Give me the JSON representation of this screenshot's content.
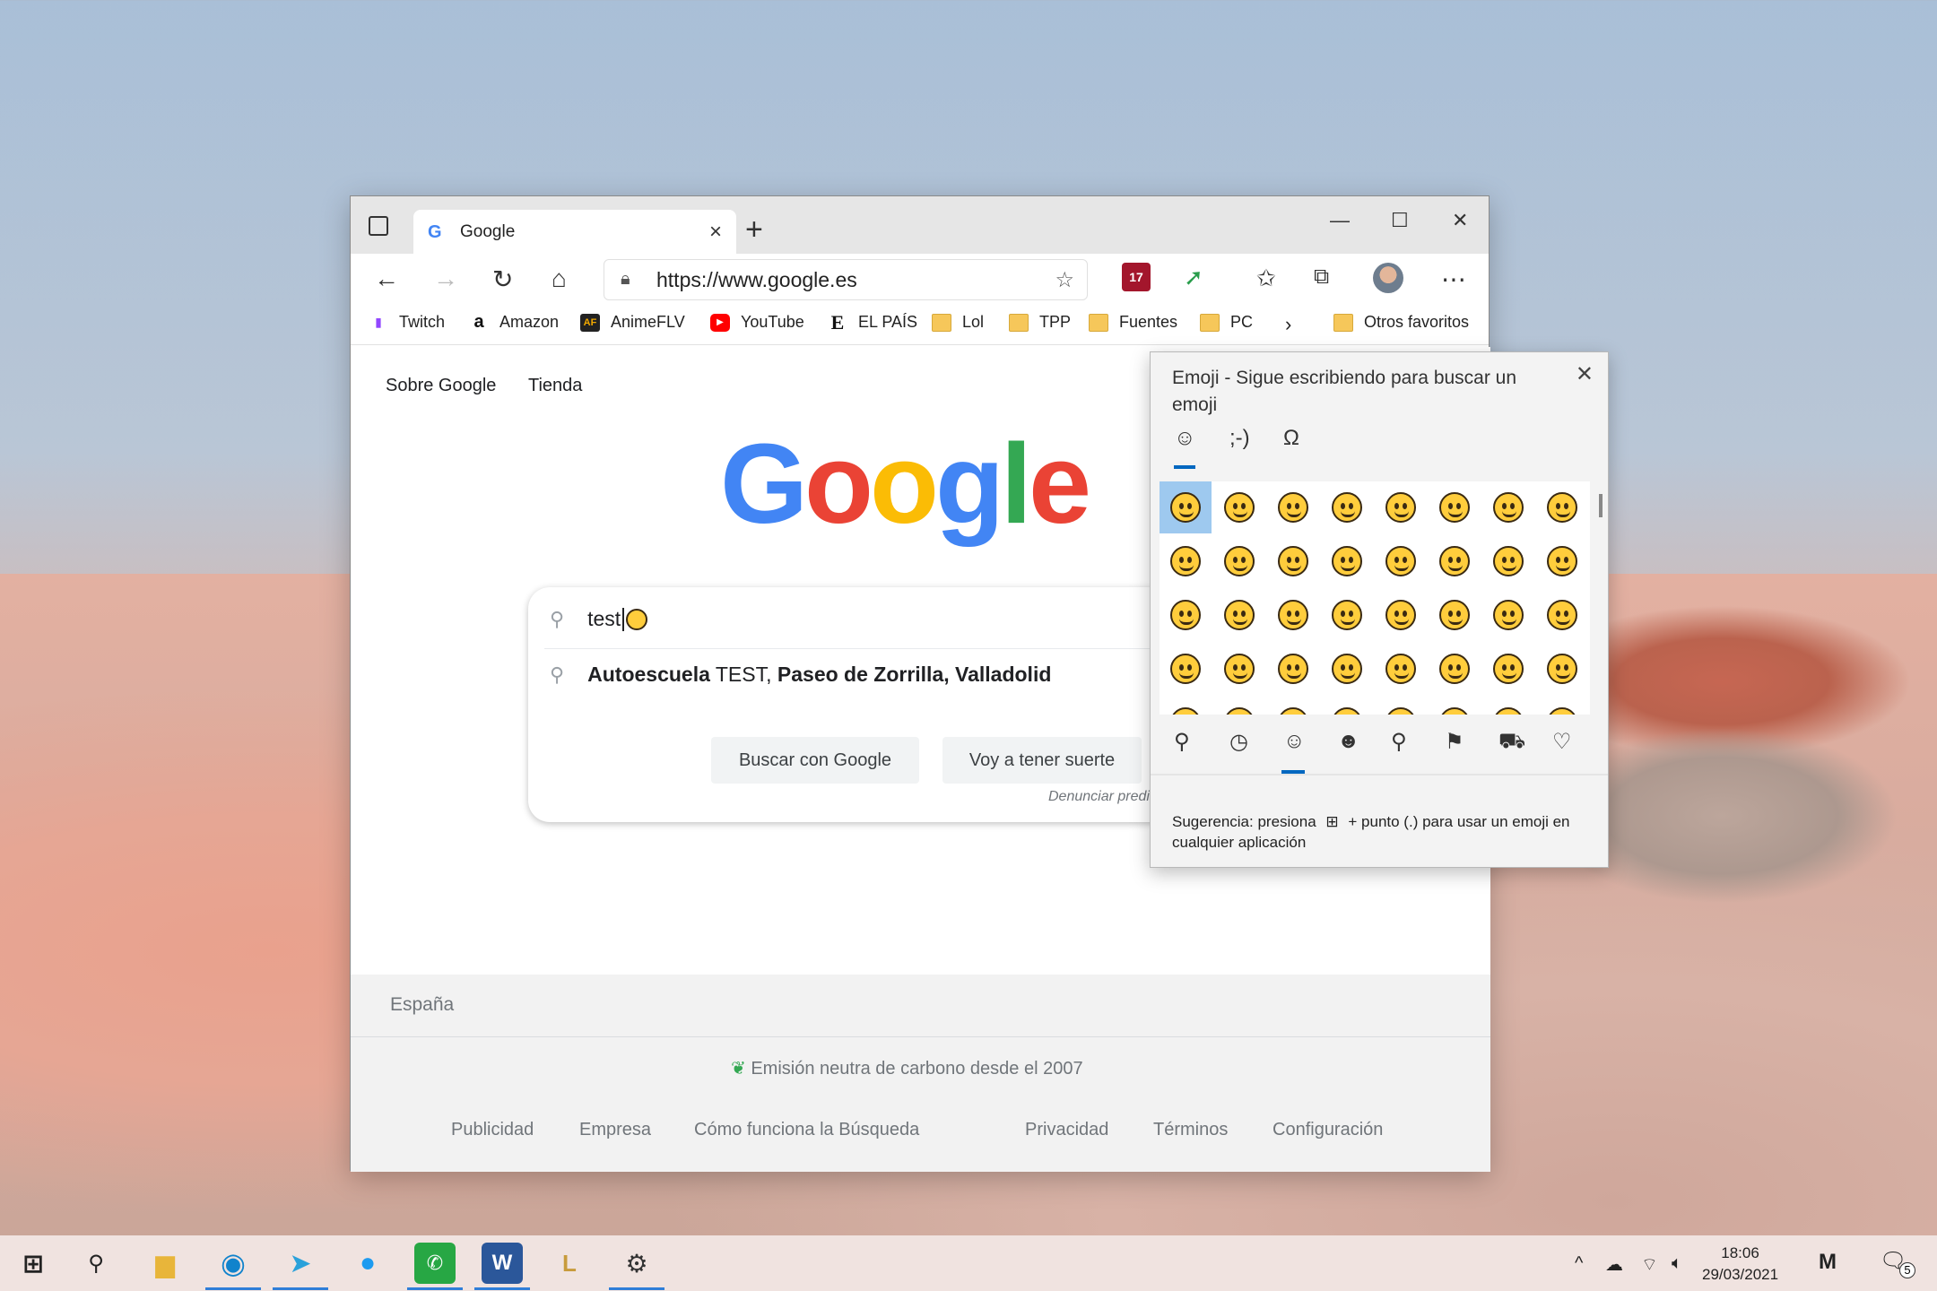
{
  "browser": {
    "tab_title": "Google",
    "url": "https://www.google.es",
    "tracking_badge": "17",
    "bookmarks": [
      "Twitch",
      "Amazon",
      "AnimeFLV",
      "YouTube",
      "EL PAÍS",
      "Lol",
      "TPP",
      "Fuentes",
      "PC"
    ],
    "other_favorites": "Otros favoritos"
  },
  "google": {
    "top_links": [
      "Sobre Google",
      "Tienda"
    ],
    "logo_letters": [
      "G",
      "o",
      "o",
      "g",
      "l",
      "e"
    ],
    "logo_colors": [
      "#4285F4",
      "#EA4335",
      "#FBBC05",
      "#4285F4",
      "#34A853",
      "#EA4335"
    ],
    "query": "test",
    "suggestion_bold1": "Autoescuela",
    "suggestion_plain": " TEST,",
    "suggestion_bold2": " Paseo de Zorrilla, Valladolid",
    "btn_search": "Buscar con Google",
    "btn_lucky": "Voy a tener suerte",
    "report": "Denunciar predi",
    "country": "España",
    "carbon": "Emisión neutra de carbono desde el 2007",
    "footer_links": [
      "Publicidad",
      "Empresa",
      "Cómo funciona la Búsqueda",
      "Privacidad",
      "Términos",
      "Configuración"
    ]
  },
  "emoji_panel": {
    "title": "Emoji - Sigue escribiendo para buscar un emoji",
    "tabs": [
      "☺",
      ";-)",
      "Ω"
    ],
    "categories": [
      "search-icon",
      "recent-icon",
      "smiley-icon",
      "people-icon",
      "places-icon",
      "celebration-icon",
      "transport-icon",
      "heart-icon"
    ],
    "tip_prefix": "Sugerencia: presiona",
    "tip_suffix": "+ punto (.) para usar un emoji en cualquier aplicación"
  },
  "taskbar": {
    "time": "18:06",
    "date": "29/03/2021",
    "notifications": "5",
    "accent": "#2f7ed8"
  }
}
